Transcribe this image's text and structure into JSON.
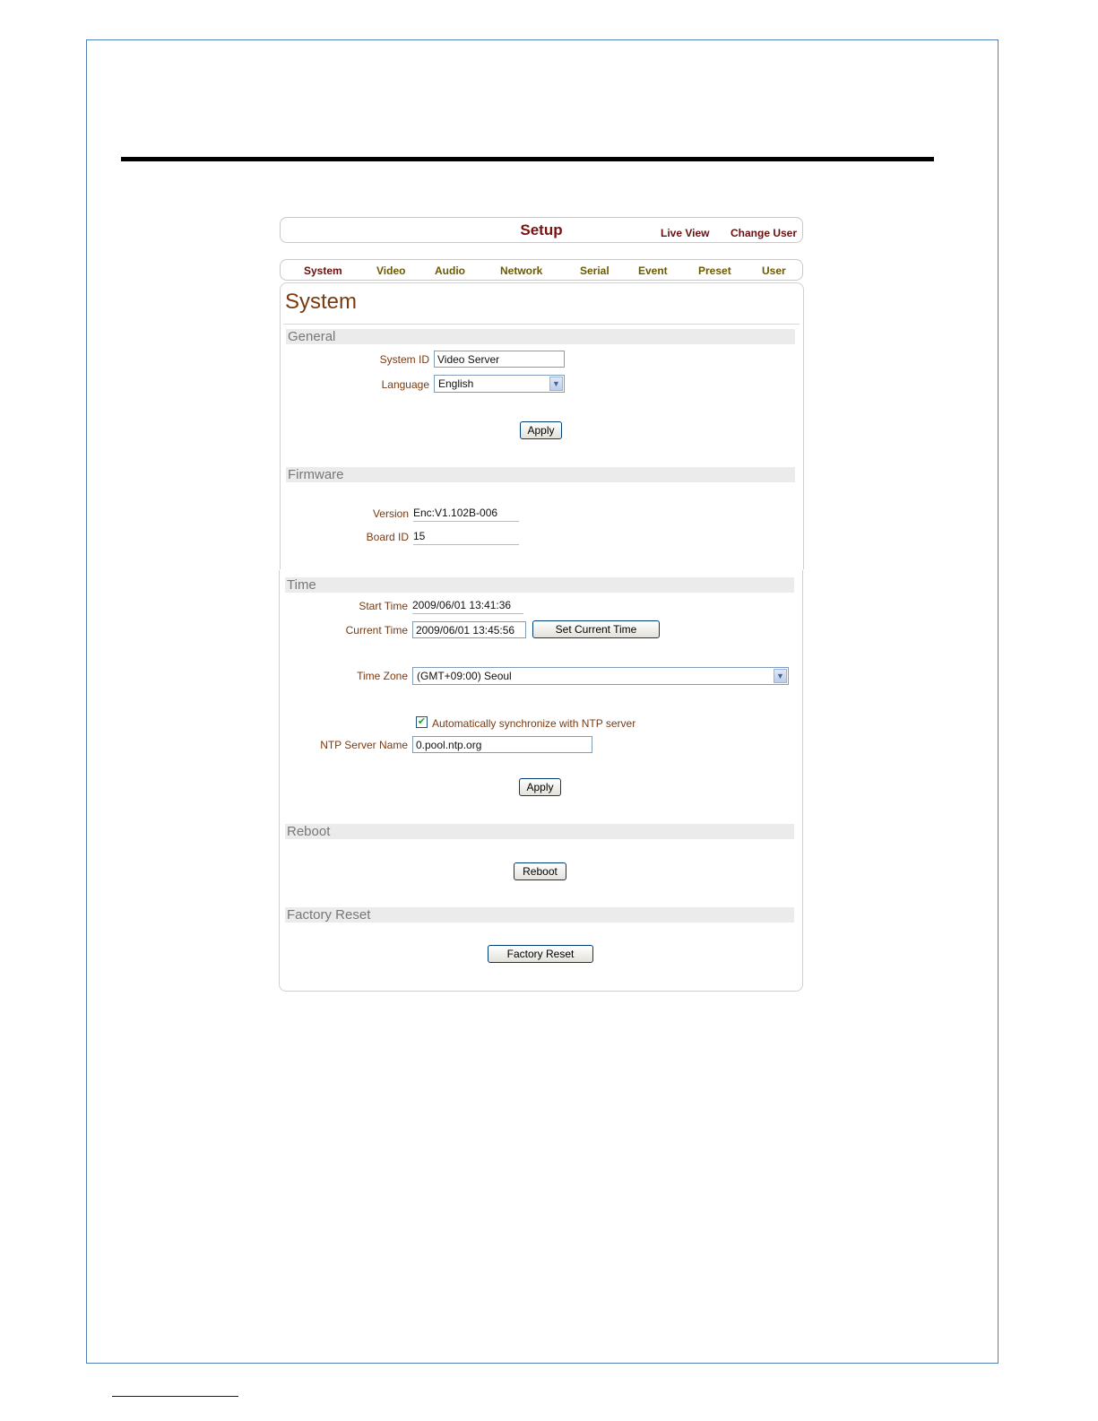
{
  "topbar": {
    "title": "Setup",
    "live_view": "Live View",
    "change_user": "Change User"
  },
  "tabs": [
    {
      "label": "System",
      "active": true
    },
    {
      "label": "Video"
    },
    {
      "label": "Audio"
    },
    {
      "label": "Network"
    },
    {
      "label": "Serial"
    },
    {
      "label": "Event"
    },
    {
      "label": "Preset"
    },
    {
      "label": "User"
    }
  ],
  "page_title": "System",
  "general": {
    "heading": "General",
    "system_id_label": "System ID",
    "system_id_value": "Video Server",
    "language_label": "Language",
    "language_value": "English",
    "apply_label": "Apply"
  },
  "firmware": {
    "heading": "Firmware",
    "version_label": "Version",
    "version_value": "Enc:V1.102B-006",
    "board_id_label": "Board ID",
    "board_id_value": "15"
  },
  "time": {
    "heading": "Time",
    "start_time_label": "Start Time",
    "start_time_value": "2009/06/01 13:41:36",
    "current_time_label": "Current Time",
    "current_time_value": "2009/06/01 13:45:56",
    "set_current_time_label": "Set Current Time",
    "time_zone_label": "Time Zone",
    "time_zone_value": "(GMT+09:00) Seoul",
    "ntp_sync_label": "Automatically synchronize with NTP server",
    "ntp_sync_checked": true,
    "ntp_server_label": "NTP Server Name",
    "ntp_server_value": "0.pool.ntp.org",
    "apply_label": "Apply"
  },
  "reboot": {
    "heading": "Reboot",
    "button_label": "Reboot"
  },
  "factory_reset": {
    "heading": "Factory Reset",
    "button_label": "Factory Reset"
  },
  "colors": {
    "accent": "#7a1010",
    "label": "#7a3a10",
    "tab": "#6b5a00",
    "section_bar": "#ebebeb"
  }
}
